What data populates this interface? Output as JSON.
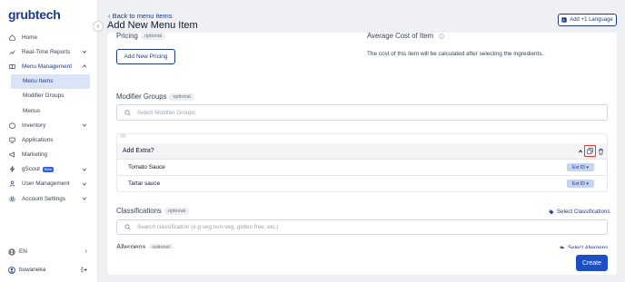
{
  "brand": {
    "logo": "grubtech"
  },
  "sidebar": {
    "items": [
      {
        "label": "Home",
        "icon": "home-icon"
      },
      {
        "label": "Real-Time Reports",
        "icon": "chart-icon",
        "chevron": true
      },
      {
        "label": "Menu Management",
        "icon": "menu-book-icon",
        "chevron": true,
        "expanded": true
      },
      {
        "label": "Menu Items",
        "sub": true,
        "active": true
      },
      {
        "label": "Modifier Groups",
        "sub": true
      },
      {
        "label": "Menus",
        "sub": true
      },
      {
        "label": "Inventory",
        "icon": "box-icon",
        "chevron": true
      },
      {
        "label": "Applications",
        "icon": "monitor-icon"
      },
      {
        "label": "Marketing",
        "icon": "megaphone-icon"
      },
      {
        "label": "gScout",
        "icon": "bolt-icon",
        "badge": "Beta",
        "chevron": true
      },
      {
        "label": "User Management",
        "icon": "user-icon",
        "chevron": true
      },
      {
        "label": "Account Settings",
        "icon": "gear-icon",
        "chevron": true
      }
    ],
    "language": "EN",
    "username": "buwaneka"
  },
  "header": {
    "back_label": "Back to menu items",
    "title": "Add New Menu Item",
    "add_language_label": "Add +1 Language"
  },
  "pricing": {
    "label": "Pricing",
    "tag": "optional",
    "add_button": "Add New Pricing"
  },
  "average_cost": {
    "label": "Average Cost of Item",
    "description": "The cost of this item will be calculated after selecting the ingredients."
  },
  "modifier_groups": {
    "label": "Modifier Groups",
    "tag": "optional",
    "placeholder": "Select Modifier Groups",
    "group": {
      "name": "Add Extra?",
      "modifiers": [
        {
          "name": "Tomato Sauce",
          "badge": "Ext ID"
        },
        {
          "name": "Tartar sauce",
          "badge": "Ext ID"
        }
      ]
    }
  },
  "classifications": {
    "label": "Classifications",
    "tag": "optional",
    "placeholder": "Search classification (e.g veg,non-veg, gluten free, etc.)",
    "select_link": "Select Classifications"
  },
  "allergens": {
    "label": "Allergens",
    "tag": "optional",
    "select_link": "Select Allergens"
  },
  "actions": {
    "create": "Create"
  },
  "colors": {
    "primary": "#1e4fc2",
    "accent": "#1e3a8a",
    "highlight": "#e53935"
  }
}
